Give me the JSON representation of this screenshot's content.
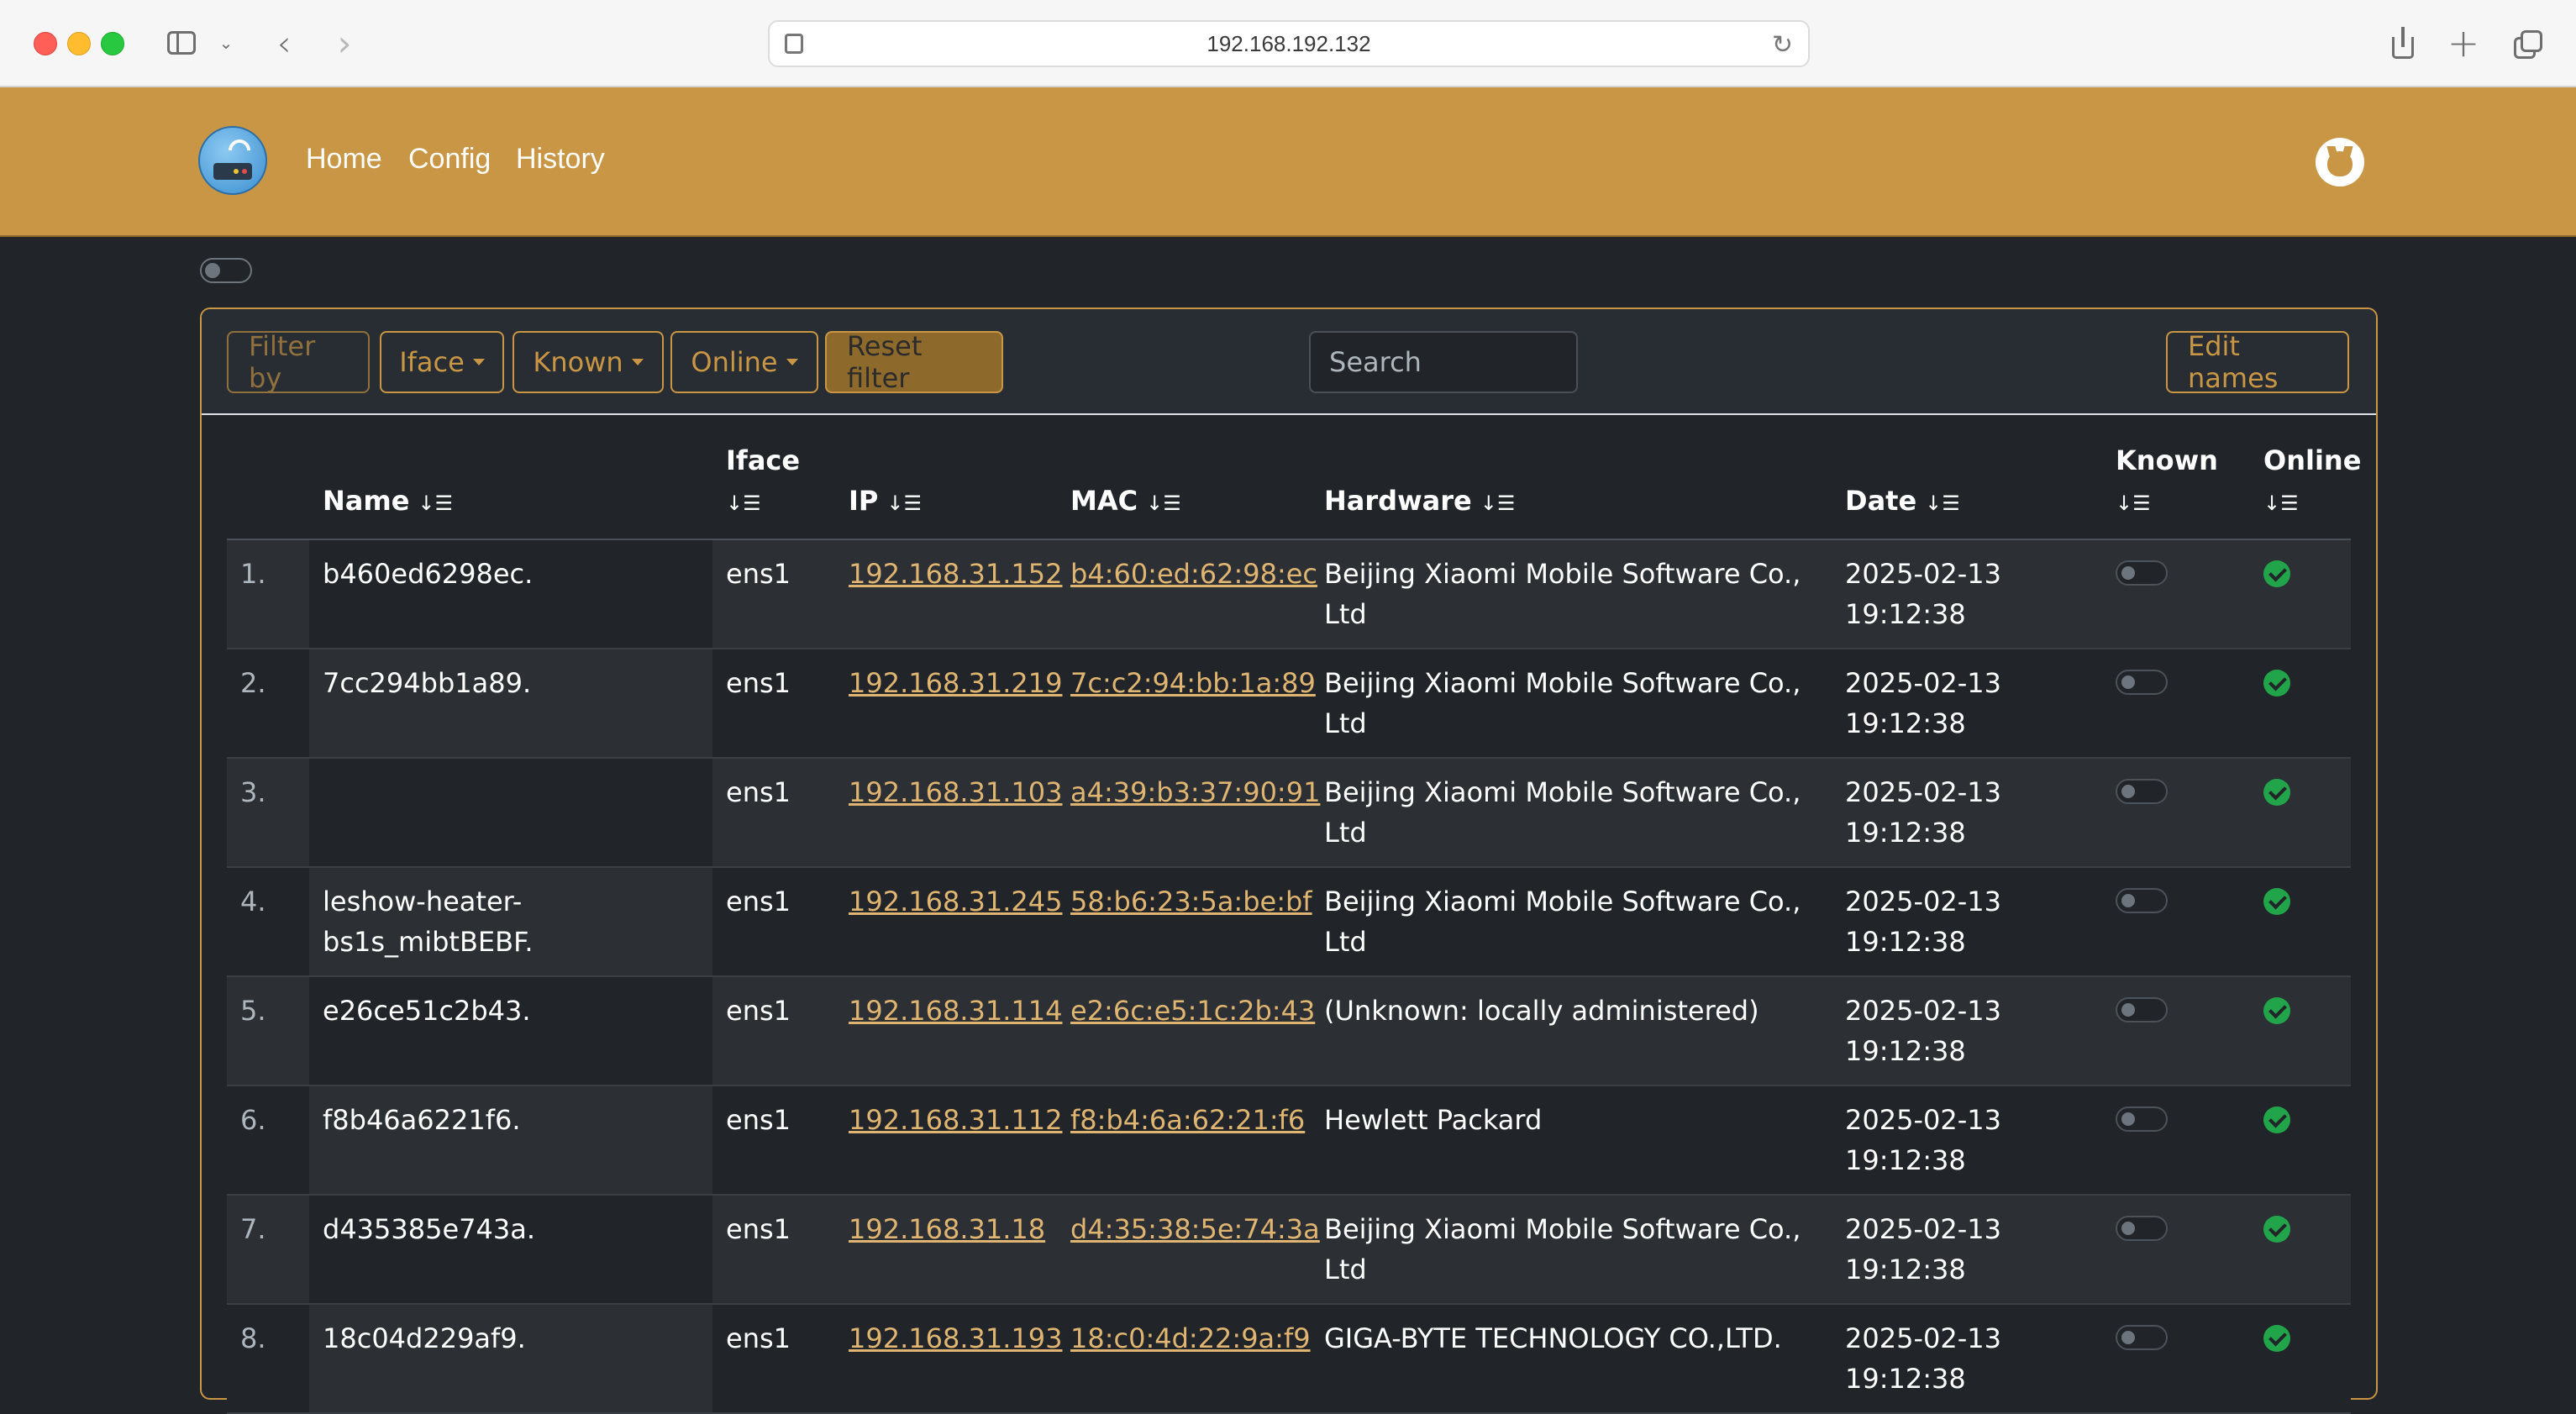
{
  "browser": {
    "url": "192.168.192.132"
  },
  "nav": {
    "home": "Home",
    "config": "Config",
    "history": "History"
  },
  "toolbar": {
    "filter_by": "Filter by",
    "iface": "Iface",
    "known": "Known",
    "online": "Online",
    "reset_filter": "Reset filter",
    "search_placeholder": "Search",
    "edit_names": "Edit names"
  },
  "table": {
    "columns": {
      "name": "Name",
      "iface": "Iface",
      "ip": "IP",
      "mac": "MAC",
      "hardware": "Hardware",
      "date": "Date",
      "known": "Known",
      "online": "Online"
    },
    "rows": [
      {
        "num": "1.",
        "name": "b460ed6298ec.",
        "iface": "ens1",
        "ip": "192.168.31.152",
        "mac": "b4:60:ed:62:98:ec",
        "hardware": "Beijing Xiaomi Mobile Software Co., Ltd",
        "date": "2025-02-13 19:12:38",
        "known": false,
        "online": true
      },
      {
        "num": "2.",
        "name": "7cc294bb1a89.",
        "iface": "ens1",
        "ip": "192.168.31.219",
        "mac": "7c:c2:94:bb:1a:89",
        "hardware": "Beijing Xiaomi Mobile Software Co., Ltd",
        "date": "2025-02-13 19:12:38",
        "known": false,
        "online": true
      },
      {
        "num": "3.",
        "name": "",
        "iface": "ens1",
        "ip": "192.168.31.103",
        "mac": "a4:39:b3:37:90:91",
        "hardware": "Beijing Xiaomi Mobile Software Co., Ltd",
        "date": "2025-02-13 19:12:38",
        "known": false,
        "online": true
      },
      {
        "num": "4.",
        "name": "leshow-heater-bs1s_mibtBEBF.",
        "iface": "ens1",
        "ip": "192.168.31.245",
        "mac": "58:b6:23:5a:be:bf",
        "hardware": "Beijing Xiaomi Mobile Software Co., Ltd",
        "date": "2025-02-13 19:12:38",
        "known": false,
        "online": true
      },
      {
        "num": "5.",
        "name": "e26ce51c2b43.",
        "iface": "ens1",
        "ip": "192.168.31.114",
        "mac": "e2:6c:e5:1c:2b:43",
        "hardware": "(Unknown: locally administered)",
        "date": "2025-02-13 19:12:38",
        "known": false,
        "online": true
      },
      {
        "num": "6.",
        "name": "f8b46a6221f6.",
        "iface": "ens1",
        "ip": "192.168.31.112",
        "mac": "f8:b4:6a:62:21:f6",
        "hardware": "Hewlett Packard",
        "date": "2025-02-13 19:12:38",
        "known": false,
        "online": true
      },
      {
        "num": "7.",
        "name": "d435385e743a.",
        "iface": "ens1",
        "ip": "192.168.31.18",
        "mac": "d4:35:38:5e:74:3a",
        "hardware": "Beijing Xiaomi Mobile Software Co., Ltd",
        "date": "2025-02-13 19:12:38",
        "known": false,
        "online": true
      },
      {
        "num": "8.",
        "name": "18c04d229af9.",
        "iface": "ens1",
        "ip": "192.168.31.193",
        "mac": "18:c0:4d:22:9a:f9",
        "hardware": "GIGA-BYTE TECHNOLOGY CO.,LTD.",
        "date": "2025-02-13 19:12:38",
        "known": false,
        "online": true
      }
    ]
  },
  "colors": {
    "accent": "#c89644",
    "background": "#212529",
    "online": "#22a44a"
  }
}
